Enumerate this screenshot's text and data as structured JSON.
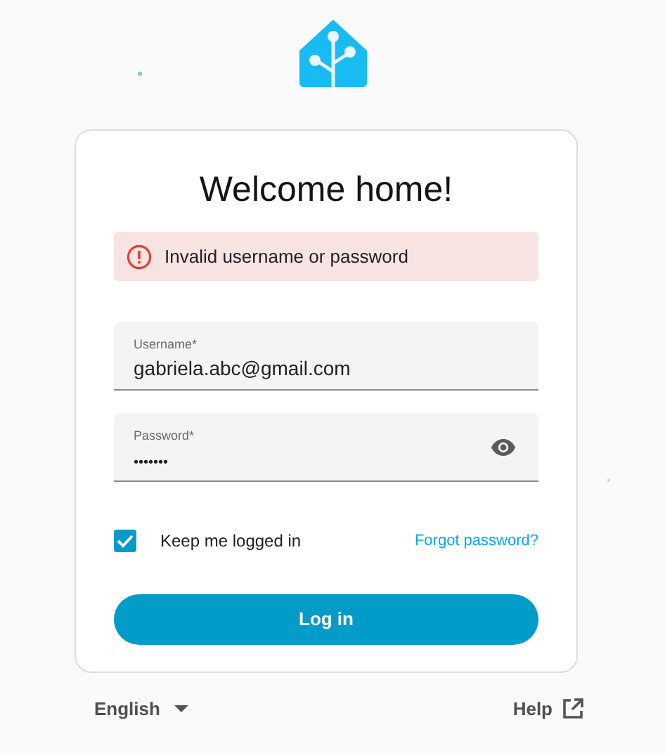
{
  "title": "Welcome home!",
  "error": {
    "message": "Invalid username or password"
  },
  "fields": [
    {
      "label": "Username*",
      "value": "gabriela.abc@gmail.com",
      "kind": "text"
    },
    {
      "label": "Password*",
      "value": "•••••••",
      "kind": "password"
    }
  ],
  "keep_logged_in": {
    "label": "Keep me logged in",
    "checked": true
  },
  "forgot_link": "Forgot password?",
  "login_button": "Log in",
  "language": "English",
  "help": "Help"
}
